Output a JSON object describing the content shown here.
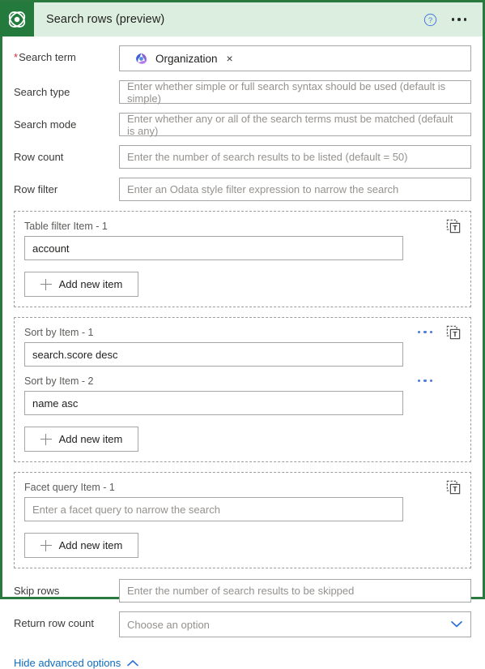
{
  "header": {
    "title": "Search rows (preview)",
    "app_icon": "dataverse-logo-icon",
    "help_icon": "help-circle-icon",
    "more_icon": "more-horizontal-icon",
    "bg_color": "#dceedf",
    "accent_color": "#237a3c"
  },
  "fields": [
    {
      "label": "Search term",
      "required": true,
      "type": "token",
      "token": {
        "icon": "dataverse-swirl-icon",
        "label": "Organization",
        "remove": "×"
      }
    },
    {
      "label": "Search type",
      "required": false,
      "type": "text",
      "value": "",
      "placeholder": "Enter whether simple or full search syntax should be used (default is simple)"
    },
    {
      "label": "Search mode",
      "required": false,
      "type": "text",
      "value": "",
      "placeholder": "Enter whether any or all of the search terms must be matched (default is any)"
    },
    {
      "label": "Row count",
      "required": false,
      "type": "text",
      "value": "",
      "placeholder": "Enter the number of search results to be listed (default = 50)"
    },
    {
      "label": "Row filter",
      "required": false,
      "type": "text",
      "value": "",
      "placeholder": "Enter an Odata style filter expression to narrow the search"
    }
  ],
  "sections": [
    {
      "name": "table-filter",
      "items": [
        {
          "label": "Table filter Item - 1",
          "value": "account",
          "placeholder": "",
          "has_menu": false,
          "has_text_toggle": true
        }
      ],
      "add_label": "Add new item"
    },
    {
      "name": "sort-by",
      "items": [
        {
          "label": "Sort by Item - 1",
          "value": "search.score desc",
          "placeholder": "",
          "has_menu": true,
          "has_text_toggle": true
        },
        {
          "label": "Sort by Item - 2",
          "value": "name asc",
          "placeholder": "",
          "has_menu": true,
          "has_text_toggle": false
        }
      ],
      "add_label": "Add new item"
    },
    {
      "name": "facet-query",
      "items": [
        {
          "label": "Facet query Item - 1",
          "value": "",
          "placeholder": "Enter a facet query to narrow the search",
          "has_menu": false,
          "has_text_toggle": true
        }
      ],
      "add_label": "Add new item"
    }
  ],
  "trailing_fields": [
    {
      "label": "Skip rows",
      "required": false,
      "type": "text",
      "value": "",
      "placeholder": "Enter the number of search results to be skipped"
    },
    {
      "label": "Return row count",
      "required": false,
      "type": "dropdown",
      "value": "",
      "placeholder": "Choose an option",
      "chevron": "chevron-down-icon"
    }
  ],
  "advanced": {
    "label": "Hide advanced options",
    "chevron": "chevron-up-icon",
    "link_color": "#0f6cbd"
  }
}
